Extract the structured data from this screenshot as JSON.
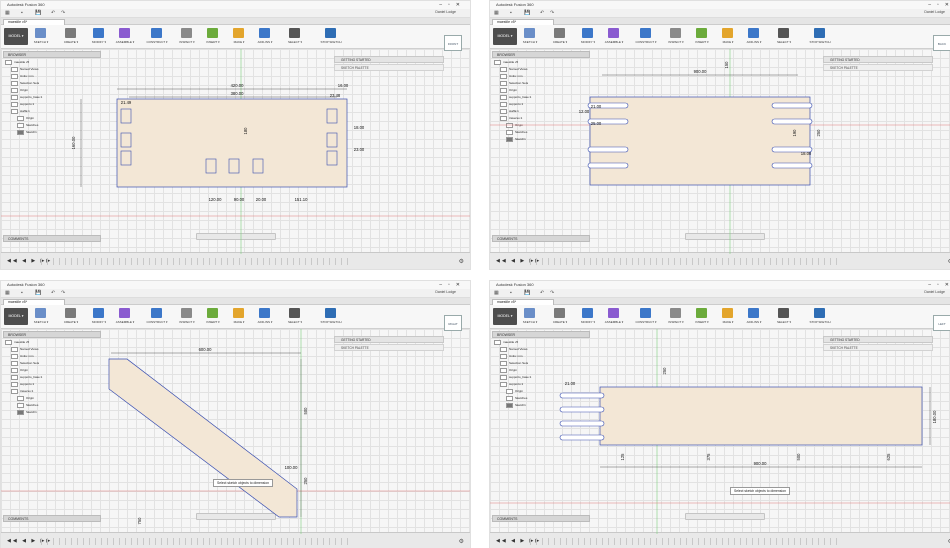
{
  "panes": [
    {
      "title": "Autodesk Fusion 360",
      "user": "Daniel Lodge",
      "doc_tab": "maestile v5*",
      "undo_label": "undo",
      "model_label": "MODEL ▾",
      "ribbon": [
        "SKETCH ▾",
        "CREATE ▾",
        "MODIFY ▾",
        "ASSEMBLE ▾",
        "CONSTRUCT ▾",
        "INSPECT ▾",
        "INSERT ▾",
        "MAKE ▾",
        "ADD-INS ▾",
        "SELECT ▾",
        "STOP SKETCH"
      ],
      "browser": "BROWSER",
      "tree": [
        "maestile v5",
        "Named Views",
        "Units: mm",
        "Selection Sets",
        "Origin",
        "supporto_base:1",
        "supporto:1",
        "staffa:1",
        "Origin",
        "Sketches",
        "Sketch1"
      ],
      "getting_started": "GETTING STARTED",
      "sketch_palette": "SKETCH PALETTE",
      "viewcube": "FRONT",
      "comments": "COMMENTS",
      "dims": [
        "420.00",
        "380.00",
        "16.00",
        "23.48",
        "21.49",
        "160.00",
        "151.10",
        "120.00",
        "180",
        "90.00",
        "20.00",
        "18.00",
        "23.00"
      ],
      "hint": ""
    },
    {
      "title": "Autodesk Fusion 360",
      "user": "Daniel Lodge",
      "doc_tab": "maestile v5*",
      "undo_label": "undo",
      "model_label": "MODEL ▾",
      "ribbon": [
        "SKETCH ▾",
        "CREATE ▾",
        "MODIFY ▾",
        "ASSEMBLE ▾",
        "CONSTRUCT ▾",
        "INSPECT ▾",
        "INSERT ▾",
        "MAKE ▾",
        "ADD-INS ▾",
        "SELECT ▾",
        "STOP SKETCH"
      ],
      "browser": "BROWSER",
      "tree": [
        "maestile v5",
        "Named Views",
        "Units: mm",
        "Selection Sets",
        "Origin",
        "supporto_base:1",
        "supporto:1",
        "staffa:1",
        "traverso:1",
        "Origin",
        "Sketches",
        "Sketch1"
      ],
      "getting_started": "GETTING STARTED",
      "sketch_palette": "SKETCH PALETTE",
      "viewcube": "BACK",
      "comments": "COMMENTS",
      "dims": [
        "900.00",
        "250",
        "190",
        "21.00",
        "150",
        "25.00",
        "12.00",
        "18.00"
      ],
      "hint": ""
    },
    {
      "title": "Autodesk Fusion 360",
      "user": "Daniel Lodge",
      "doc_tab": "maestile v5*",
      "undo_label": "undo",
      "model_label": "MODEL ▾",
      "ribbon": [
        "SKETCH ▾",
        "CREATE ▾",
        "MODIFY ▾",
        "ASSEMBLE ▾",
        "CONSTRUCT ▾",
        "INSPECT ▾",
        "INSERT ▾",
        "MAKE ▾",
        "ADD-INS ▾",
        "SELECT ▾",
        "STOP SKETCH"
      ],
      "browser": "BROWSER",
      "tree": [
        "maestile v5",
        "Named Views",
        "Units: mm",
        "Selection Sets",
        "Origin",
        "supporto_base:1",
        "supporto:1",
        "traverso:1",
        "Origin",
        "Sketches",
        "Sketch1"
      ],
      "getting_started": "GETTING STARTED",
      "sketch_palette": "SKETCH PALETTE",
      "viewcube": "RIGHT",
      "comments": "COMMENTS",
      "dims": [
        "600.00",
        "100.00",
        "500",
        "250",
        "750"
      ],
      "hint": "Select sketch objects to dimension"
    },
    {
      "title": "Autodesk Fusion 360",
      "user": "Daniel Lodge",
      "doc_tab": "maestile v5*",
      "undo_label": "undo",
      "model_label": "MODEL ▾",
      "ribbon": [
        "SKETCH ▾",
        "CREATE ▾",
        "MODIFY ▾",
        "ASSEMBLE ▾",
        "CONSTRUCT ▾",
        "INSPECT ▾",
        "INSERT ▾",
        "MAKE ▾",
        "ADD-INS ▾",
        "SELECT ▾",
        "STOP SKETCH"
      ],
      "browser": "BROWSER",
      "tree": [
        "maestile v5",
        "Named Views",
        "Units: mm",
        "Selection Sets",
        "Origin",
        "supporto_base:1",
        "supporto:1",
        "Origin",
        "Sketches",
        "Sketch1"
      ],
      "getting_started": "GETTING STARTED",
      "sketch_palette": "SKETCH PALETTE",
      "viewcube": "LEFT",
      "comments": "COMMENTS",
      "dims": [
        "900.00",
        "180.00",
        "21.00",
        "250",
        "125",
        "375",
        "500",
        "625"
      ],
      "hint": "Select sketch objects to dimension"
    }
  ],
  "colors": {
    "ribbon_icons": [
      "#6a8ec8",
      "#7a7a7a",
      "#3c77c9",
      "#8a5bd0",
      "#3c77c9",
      "#8a8a8a",
      "#6cab3c",
      "#e3a52c",
      "#3c77c9",
      "#555",
      "#2e6db4",
      "#49a04a"
    ],
    "sketch_fill": "#f3e7d6",
    "sketch_line": "#3a4fb0",
    "axis_green": "#7fd07f",
    "axis_red": "#e07a7a"
  }
}
